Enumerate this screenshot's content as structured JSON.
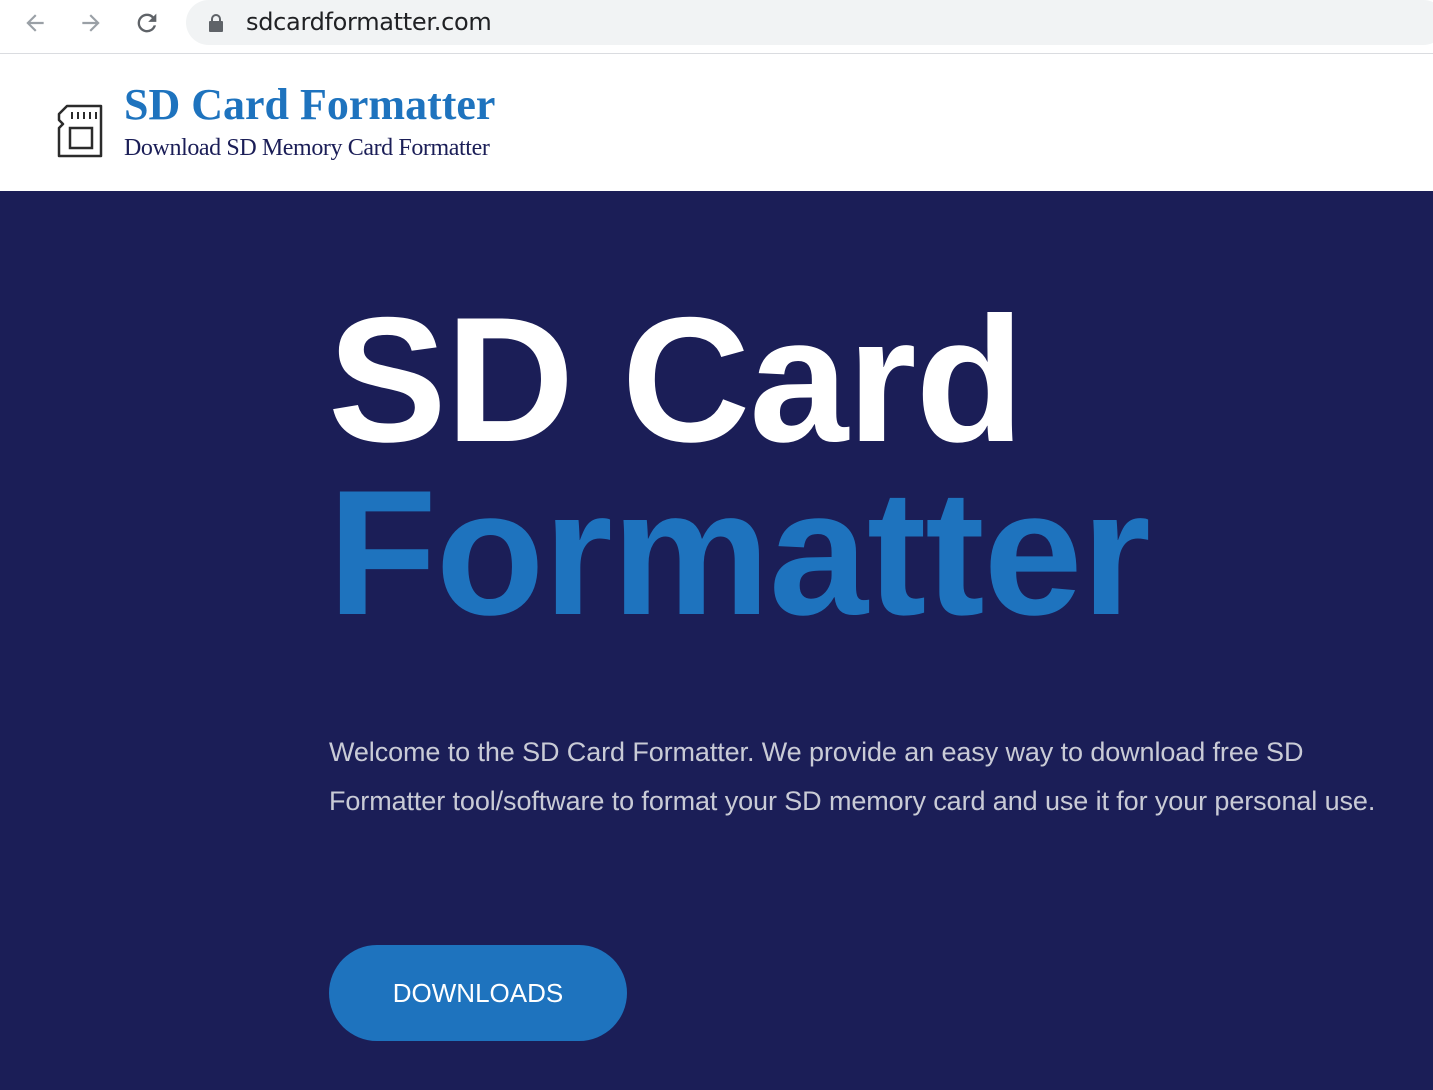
{
  "browser": {
    "url": "sdcardformatter.com",
    "icons": [
      "back-arrow-icon",
      "forward-arrow-icon",
      "reload-icon",
      "lock-icon"
    ]
  },
  "header": {
    "title": "SD Card Formatter",
    "tagline": "Download SD Memory Card Formatter",
    "logo_icon": "sd-card-icon"
  },
  "hero": {
    "line1": "SD Card",
    "line2": "Formatter",
    "description": "Welcome to the SD Card Formatter. We provide an easy way to download free SD Formatter tool/software to format your SD memory card and use it for your personal use.",
    "button_label": "DOWNLOADS"
  },
  "colors": {
    "hero_background": "#1b1e57",
    "accent_blue": "#1e73be",
    "white": "#ffffff"
  }
}
